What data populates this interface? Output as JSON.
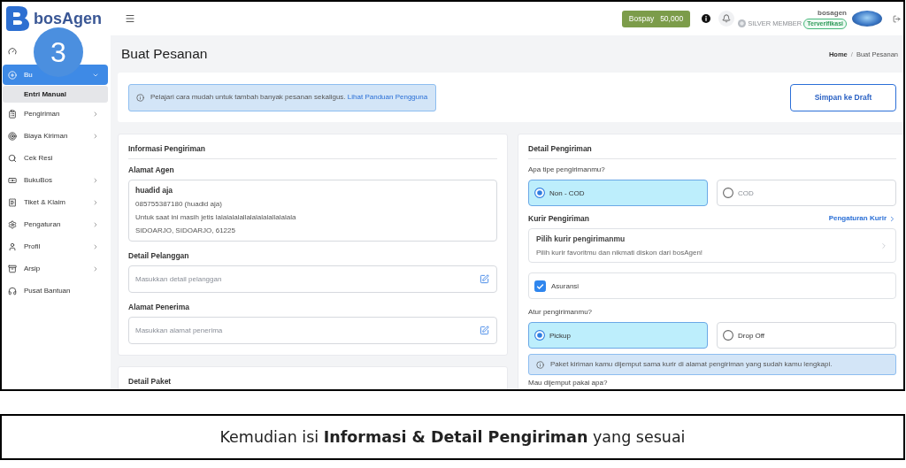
{
  "header": {
    "logo_text": "bosAgen",
    "wallet": {
      "label": "Bospay",
      "amount": "50,000"
    },
    "user": {
      "name": "bosagen",
      "tier": "SILVER MEMBER",
      "badge": "Terverifikasi"
    }
  },
  "step_badge": "3",
  "sidebar": {
    "items": [
      {
        "kind": "link",
        "selected": false
      },
      {
        "kind": "group",
        "label": "Bu",
        "selected": true,
        "expanded": true,
        "children": [
          {
            "label": "Entri Manual",
            "selected": true
          }
        ]
      },
      {
        "kind": "group",
        "label": "Pengiriman",
        "selected": false,
        "expanded": false
      },
      {
        "kind": "group",
        "label": "Biaya Kiriman",
        "selected": false,
        "expanded": false
      },
      {
        "kind": "link",
        "label": "Cek Resi",
        "selected": false
      },
      {
        "kind": "group",
        "label": "BukuBos",
        "selected": false,
        "expanded": false
      },
      {
        "kind": "group",
        "label": "Tiket & Klaim",
        "selected": false,
        "expanded": false
      },
      {
        "kind": "group",
        "label": "Pengaturan",
        "selected": false,
        "expanded": false
      },
      {
        "kind": "group",
        "label": "Profil",
        "selected": false,
        "expanded": false
      },
      {
        "kind": "group",
        "label": "Arsip",
        "selected": false,
        "expanded": false
      },
      {
        "kind": "link",
        "label": "Pusat Bantuan",
        "selected": false
      }
    ]
  },
  "page": {
    "title": "Buat Pesanan",
    "breadcrumb": {
      "items": [
        "Home",
        "Buat Pesanan"
      ],
      "separator": "/"
    }
  },
  "notice": {
    "text": "Pelajari cara mudah untuk tambah banyak pesanan sekaligus.",
    "link": "Lihat Panduan Pengguna"
  },
  "draft_button": "Simpan ke Draft",
  "shipping_info": {
    "title": "Informasi Pengiriman",
    "agent_address": {
      "label": "Alamat Agen",
      "name": "huadid aja",
      "lines": [
        "085755387180 (huadid aja)",
        "Untuk saat ini masih jetis lalalalalallalalalalallalalala",
        "SIDOARJO, SIDOARJO, 61225"
      ]
    },
    "fields": [
      {
        "label": "Detail Pelanggan",
        "placeholder": "Masukkan detail pelanggan"
      },
      {
        "label": "Alamat Penerima",
        "placeholder": "Masukkan alamat penerima"
      }
    ]
  },
  "package": {
    "title": "Detail Paket"
  },
  "shipping_detail": {
    "title": "Detail Pengiriman",
    "type_question": "Apa tipe pengirimanmu?",
    "types": [
      {
        "label": "Non - COD",
        "selected": true,
        "disabled": false
      },
      {
        "label": "COD",
        "selected": false,
        "disabled": true
      }
    ],
    "courier": {
      "label": "Kurir Pengiriman",
      "settings_link": "Pengaturan Kurir",
      "picker_title": "Pilih kurir pengirimanmu",
      "picker_subtitle": "Pilih kurir favoritmu dan nikmati diskon dari bosAgen!"
    },
    "insurance": {
      "label": "Asuransi",
      "checked": true
    },
    "method_question": "Atur pengirimanmu?",
    "methods": [
      {
        "label": "Pickup",
        "selected": true
      },
      {
        "label": "Drop Off",
        "selected": false
      }
    ],
    "method_note": "Paket kiriman kamu dijemput sama kurir di alamat pengiriman yang sudah kamu lengkapi.",
    "pickup_question": "Mau dijemput pakai apa?"
  },
  "caption": "Kemudian isi **Informasi & Detail Pengiriman** yang sesuai"
}
